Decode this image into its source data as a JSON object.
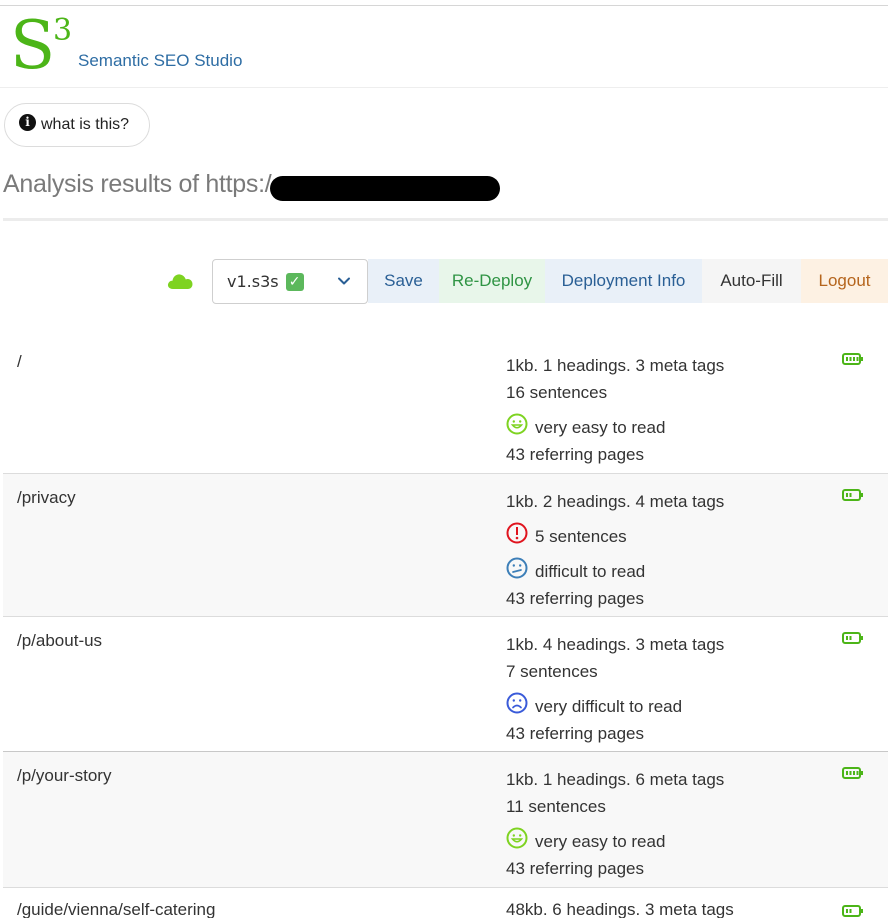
{
  "brand": {
    "logo_letter": "S",
    "logo_superscript": "3",
    "name": "Semantic SEO Studio",
    "color": "#4cb518"
  },
  "help_button": {
    "icon": "info-icon",
    "label": "what is this?"
  },
  "analysis": {
    "title_prefix": "Analysis results of https:/"
  },
  "toolbar": {
    "status_icon": "cloud-icon",
    "status_color": "#7ed321",
    "version_select": {
      "value": "v1.s3s",
      "icon": "check-mark-icon"
    },
    "buttons": {
      "save": "Save",
      "redeploy": "Re-Deploy",
      "deployment_info": "Deployment Info",
      "autofill": "Auto-Fill",
      "logout": "Logout"
    }
  },
  "pages": [
    {
      "path": "/",
      "size_line": "1kb. 1 headings. 3 meta tags",
      "sentences": "16 sentences",
      "sentences_warning": false,
      "readability": "very easy to read",
      "readability_icon": "happy-face-icon",
      "readability_color": "#7ed321",
      "referring": "43 referring pages",
      "status_icon": "battery-full-icon"
    },
    {
      "path": "/privacy",
      "size_line": "1kb. 2 headings. 4 meta tags",
      "sentences": "5 sentences",
      "sentences_warning": true,
      "warning_color": "#e0141e",
      "readability": "difficult to read",
      "readability_icon": "confused-face-icon",
      "readability_color": "#3d7fb8",
      "referring": "43 referring pages",
      "status_icon": "battery-half-icon"
    },
    {
      "path": "/p/about-us",
      "size_line": "1kb. 4 headings. 3 meta tags",
      "sentences": "7 sentences",
      "sentences_warning": false,
      "readability": "very difficult to read",
      "readability_icon": "sad-face-icon",
      "readability_color": "#3a5bd9",
      "referring": "43 referring pages",
      "status_icon": "battery-half-icon"
    },
    {
      "path": "/p/your-story",
      "size_line": "1kb. 1 headings. 6 meta tags",
      "sentences": "11 sentences",
      "sentences_warning": false,
      "readability": "very easy to read",
      "readability_icon": "happy-face-icon",
      "readability_color": "#7ed321",
      "referring": "43 referring pages",
      "status_icon": "battery-full-icon"
    },
    {
      "path": "/guide/vienna/self-catering",
      "size_line": "48kb. 6 headings. 3 meta tags",
      "status_icon": "battery-half-icon"
    }
  ]
}
